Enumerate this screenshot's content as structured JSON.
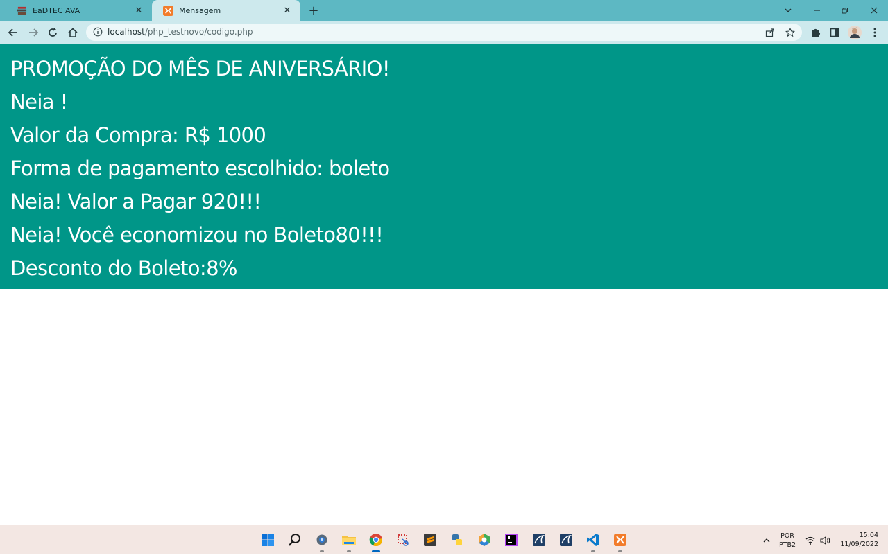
{
  "browser": {
    "tabs": [
      {
        "title": "EaDTEC AVA",
        "favicon": "stack-books-icon",
        "active": false
      },
      {
        "title": "Mensagem",
        "favicon": "xampp-icon",
        "active": true
      }
    ],
    "url_host": "localhost",
    "url_path": "/php_testnovo/codigo.php",
    "accent_color": "#5db8c3"
  },
  "page": {
    "background": "#009688",
    "lines": [
      "PROMOÇÃO DO MÊS DE ANIVERSÁRIO!",
      "Neia !",
      "Valor da Compra: R$ 1000",
      "Forma de pagamento escolhido: boleto",
      "Neia! Valor a Pagar 920!!!",
      "Neia! Você economizou no Boleto80!!!",
      "Desconto do Boleto:8%"
    ]
  },
  "taskbar": {
    "apps": [
      "windows-start-icon",
      "search-icon",
      "settings-icon",
      "file-explorer-icon",
      "chrome-icon",
      "snipping-tool-icon",
      "sublime-text-icon",
      "python-icon",
      "app-hexagon-icon",
      "phpstorm-icon",
      "mysql-workbench-icon",
      "mysql-workbench-icon",
      "vscode-icon",
      "xampp-icon"
    ],
    "language": "POR",
    "keyboard": "PTB2",
    "time": "15:04",
    "date": "11/09/2022"
  }
}
